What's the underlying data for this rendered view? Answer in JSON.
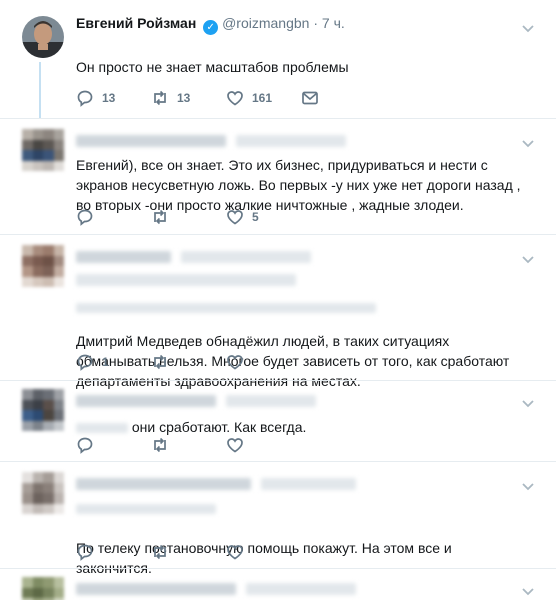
{
  "tweets": [
    {
      "author": "Евгений Ройзман",
      "handle": "@roizmangbn",
      "time": "· 7 ч.",
      "text": "Он просто не знает масштабов проблемы",
      "replies": "13",
      "retweets": "13",
      "likes": "161"
    },
    {
      "text": "Евгений), все он знает. Это их бизнес, придуриваться и нести с экранов несусветную ложь. Во первых -у них уже нет дороги назад , во вторых -они просто жалкие ничтожные , жадные злодеи.",
      "replies": "",
      "retweets": "",
      "likes": "5"
    },
    {
      "text": "Дмитрий Медведев обнадёжил людей, в таких ситуациях обманывать нельзя. Многое будет зависеть от того, как сработают департаменты здравоохранения на местах.",
      "replies": "1",
      "retweets": "",
      "likes": ""
    },
    {
      "text": "они сработают. Как всегда.",
      "replies": "",
      "retweets": "",
      "likes": ""
    },
    {
      "text": "По телеку постановочную помощь покажут. На этом все и закончится.",
      "replies": "",
      "retweets": "",
      "likes": ""
    }
  ],
  "icons": {
    "verified": "verified-badge-icon",
    "reply": "reply-icon",
    "retweet": "retweet-icon",
    "like": "heart-icon",
    "message": "envelope-icon",
    "more": "chevron-down-icon"
  },
  "colors": {
    "accent": "#1da1f2",
    "muted": "#657786",
    "divider": "#e6ecf0",
    "thread_line": "#c5e0f2"
  }
}
